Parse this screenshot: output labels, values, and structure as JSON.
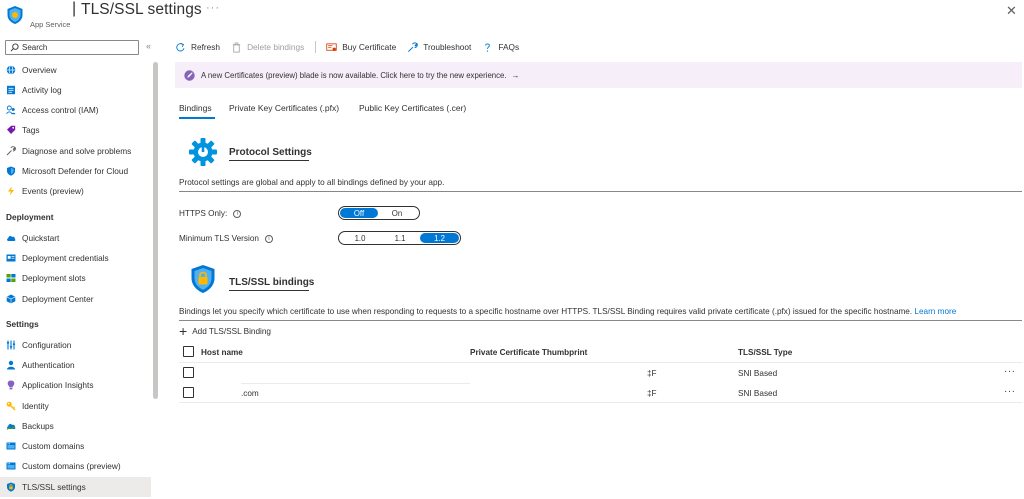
{
  "header": {
    "title": "TLS/SSL settings",
    "separator": "|",
    "subtitle": "App Service",
    "more_label": "···",
    "close_label": "✕",
    "app_icon": "app-service-icon"
  },
  "search": {
    "placeholder": "Search",
    "collapse_label": "«"
  },
  "sidebar": {
    "items": [
      {
        "label": "Overview",
        "icon": "globe-icon",
        "color": "#0078d4"
      },
      {
        "label": "Activity log",
        "icon": "log-icon",
        "color": "#0078d4"
      },
      {
        "label": "Access control (IAM)",
        "icon": "people-icon",
        "color": "#0078d4"
      },
      {
        "label": "Tags",
        "icon": "tag-icon",
        "color": "#7719aa"
      },
      {
        "label": "Diagnose and solve problems",
        "icon": "wrench-icon",
        "color": "#605e5c"
      },
      {
        "label": "Microsoft Defender for Cloud",
        "icon": "shield-icon",
        "color": "#0078d4"
      },
      {
        "label": "Events (preview)",
        "icon": "lightning-icon",
        "color": "#ffb900"
      }
    ],
    "section_deployment": "Deployment",
    "deployment_items": [
      {
        "label": "Quickstart",
        "icon": "cloud-icon",
        "color": "#0078d4"
      },
      {
        "label": "Deployment credentials",
        "icon": "credentials-icon",
        "color": "#0078d4"
      },
      {
        "label": "Deployment slots",
        "icon": "slots-icon",
        "color": "#57a300"
      },
      {
        "label": "Deployment Center",
        "icon": "cube-icon",
        "color": "#0078d4"
      }
    ],
    "section_settings": "Settings",
    "settings_items": [
      {
        "label": "Configuration",
        "icon": "sliders-icon",
        "color": "#0078d4"
      },
      {
        "label": "Authentication",
        "icon": "person-icon",
        "color": "#0078d4"
      },
      {
        "label": "Application Insights",
        "icon": "lightbulb-icon",
        "color": "#8661c5"
      },
      {
        "label": "Identity",
        "icon": "key-icon",
        "color": "#ffb900"
      },
      {
        "label": "Backups",
        "icon": "backup-cloud-icon",
        "color": "#0078d4"
      },
      {
        "label": "Custom domains",
        "icon": "domain-icon",
        "color": "#0078d4"
      },
      {
        "label": "Custom domains (preview)",
        "icon": "domain-preview-icon",
        "color": "#0078d4"
      },
      {
        "label": "TLS/SSL settings",
        "icon": "tls-shield-icon",
        "color": "#0078d4"
      }
    ]
  },
  "toolbar": {
    "refresh": "Refresh",
    "delete_bindings": "Delete bindings",
    "buy_certificate": "Buy Certificate",
    "troubleshoot": "Troubleshoot",
    "faqs": "FAQs"
  },
  "banner": {
    "text": "A new Certificates (preview) blade is now available. Click here to try the new experience.",
    "arrow": "→"
  },
  "tabs": [
    {
      "label": "Bindings"
    },
    {
      "label": "Private Key Certificates (.pfx)"
    },
    {
      "label": "Public Key Certificates (.cer)"
    }
  ],
  "protocol": {
    "title": "Protocol Settings",
    "description": "Protocol settings are global and apply to all bindings defined by your app.",
    "https_only_label": "HTTPS Only:",
    "https_options": [
      "Off",
      "On"
    ],
    "https_selected": "Off",
    "tls_label": "Minimum TLS Version",
    "tls_options": [
      "1.0",
      "1.1",
      "1.2"
    ],
    "tls_selected": "1.2",
    "info_symbol": "i"
  },
  "bindings": {
    "title": "TLS/SSL bindings",
    "description": "Bindings let you specify which certificate to use when responding to requests to a specific hostname over HTTPS. TLS/SSL Binding requires valid private certificate (.pfx) issued for the specific hostname.",
    "learn_more": "Learn more",
    "add_label": "Add TLS/SSL Binding",
    "add_symbol": "+",
    "columns": [
      "Host name",
      "Private Certificate Thumbprint",
      "TLS/SSL Type"
    ],
    "rows": [
      {
        "host": "",
        "thumbprint": "‡F",
        "type": "SNI Based",
        "more": "···"
      },
      {
        "host": ".com",
        "thumbprint": "‡F",
        "type": "SNI Based",
        "more": "···"
      }
    ]
  }
}
